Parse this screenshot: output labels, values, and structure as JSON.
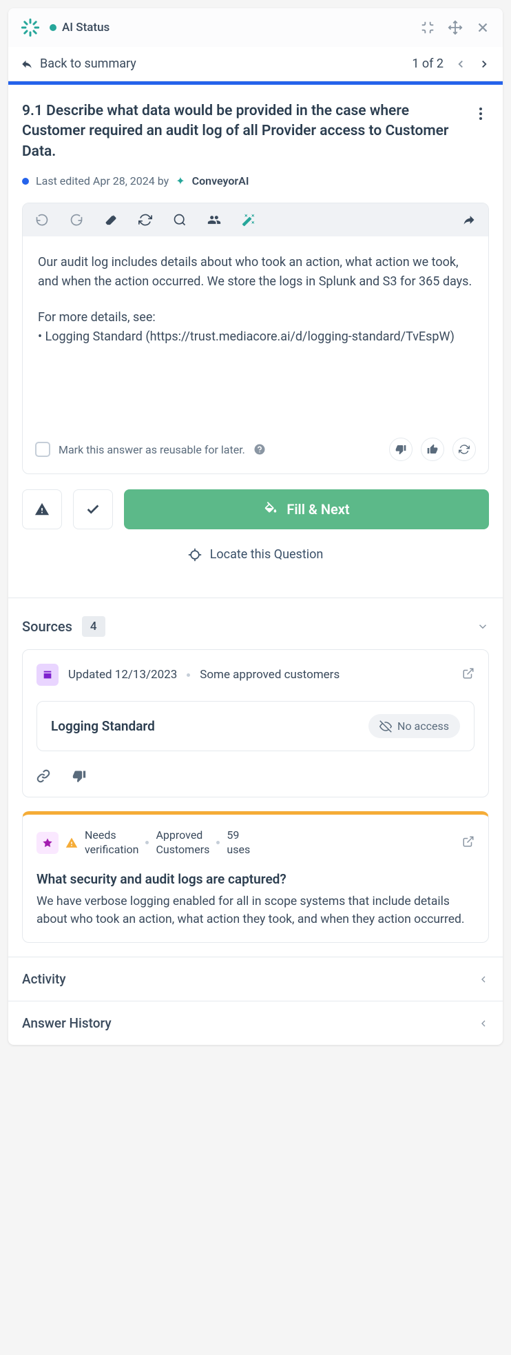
{
  "header": {
    "status_label": "AI Status"
  },
  "nav": {
    "back_label": "Back to summary",
    "pager": "1 of 2"
  },
  "question": {
    "title": "9.1 Describe what data would be provided in the case where Customer required an audit log of all Provider access to Customer Data.",
    "last_edited_prefix": "Last edited Apr 28, 2024 by",
    "ai_name": "ConveyorAI"
  },
  "answer": {
    "para1": "Our audit log includes details about who took an action, what action we took, and when the action occurred. We store the logs in Splunk and S3 for 365 days.",
    "para2_intro": "For more details, see:",
    "para2_bullet": "• Logging Standard (https://trust.mediacore.ai/d/logging-standard/TvEspW)"
  },
  "reuse": {
    "label": "Mark this answer as reusable for later."
  },
  "actions": {
    "fill_next": "Fill & Next",
    "locate": "Locate this Question"
  },
  "sources": {
    "title": "Sources",
    "count": "4",
    "card1": {
      "updated": "Updated 12/13/2023",
      "visibility": "Some approved customers",
      "title": "Logging Standard",
      "no_access": "No access"
    },
    "card2": {
      "verify_l1": "Needs",
      "verify_l2": "verification",
      "approved_l1": "Approved",
      "approved_l2": "Customers",
      "uses_l1": "59",
      "uses_l2": "uses",
      "question": "What security and audit logs are captured?",
      "answer": "We have verbose logging enabled for all in scope systems that include details about who took an action, what action they took, and when they action occurred."
    }
  },
  "sections": {
    "activity": "Activity",
    "history": "Answer History"
  }
}
